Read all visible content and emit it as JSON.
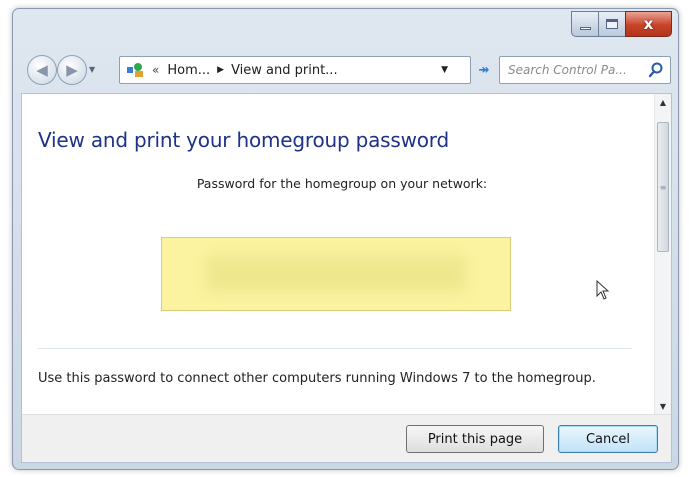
{
  "window": {
    "caption": {
      "minimize": "",
      "maximize": "",
      "close": "x"
    }
  },
  "navigation": {
    "back_icon": "back-arrow-icon",
    "forward_icon": "forward-arrow-icon",
    "address": {
      "overflow": "«",
      "crumbs": [
        "Hom...",
        "View and print..."
      ]
    },
    "search_placeholder": "Search Control Pa..."
  },
  "content": {
    "title": "View and print your homegroup password",
    "password_label": "Password for the homegroup on your network:",
    "password_value": "",
    "info_text": "Use this password to connect other computers running Windows 7 to the homegroup."
  },
  "footer": {
    "print_label": "Print this page",
    "cancel_label": "Cancel"
  },
  "colors": {
    "title": "#1e3287",
    "password_box": "#fbf39f",
    "close_button": "#c9432a"
  }
}
